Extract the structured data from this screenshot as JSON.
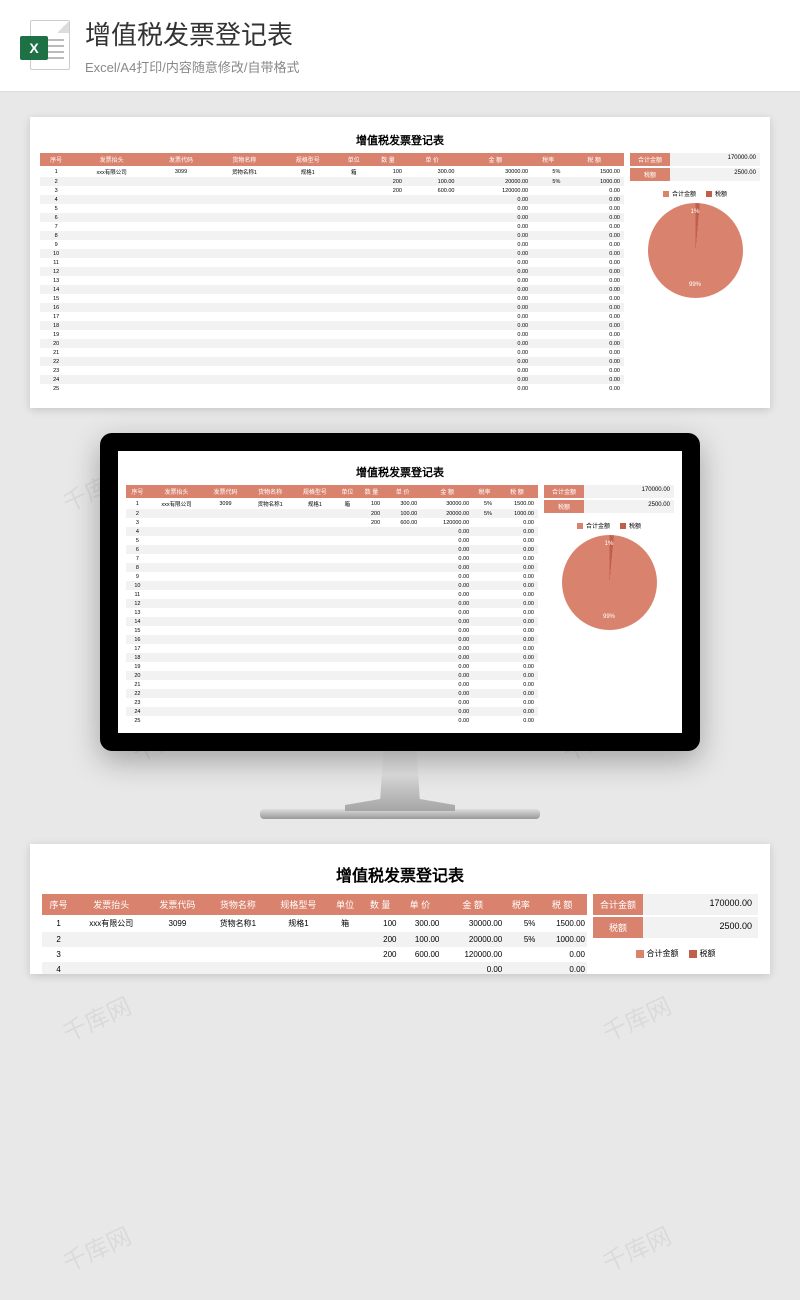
{
  "header": {
    "title": "增值税发票登记表",
    "subtitle": "Excel/A4打印/内容随意修改/自带格式",
    "icon_letter": "X"
  },
  "watermark_text": "千库网",
  "sheet": {
    "title": "增值税发票登记表",
    "columns": [
      "序号",
      "发票抬头",
      "发票代码",
      "货物名称",
      "规格型号",
      "单位",
      "数 量",
      "单 价",
      "金 额",
      "税率",
      "税 额"
    ],
    "rows": [
      {
        "no": "1",
        "head": "xxx有限公司",
        "code": "3099",
        "goods": "货物名称1",
        "spec": "规格1",
        "unit": "箱",
        "qty": "100",
        "price": "300.00",
        "amount": "30000.00",
        "rate": "5%",
        "tax": "1500.00"
      },
      {
        "no": "2",
        "head": "",
        "code": "",
        "goods": "",
        "spec": "",
        "unit": "",
        "qty": "200",
        "price": "100.00",
        "amount": "20000.00",
        "rate": "5%",
        "tax": "1000.00"
      },
      {
        "no": "3",
        "head": "",
        "code": "",
        "goods": "",
        "spec": "",
        "unit": "",
        "qty": "200",
        "price": "600.00",
        "amount": "120000.00",
        "rate": "",
        "tax": "0.00"
      },
      {
        "no": "4",
        "head": "",
        "code": "",
        "goods": "",
        "spec": "",
        "unit": "",
        "qty": "",
        "price": "",
        "amount": "0.00",
        "rate": "",
        "tax": "0.00"
      },
      {
        "no": "5",
        "head": "",
        "code": "",
        "goods": "",
        "spec": "",
        "unit": "",
        "qty": "",
        "price": "",
        "amount": "0.00",
        "rate": "",
        "tax": "0.00"
      },
      {
        "no": "6",
        "head": "",
        "code": "",
        "goods": "",
        "spec": "",
        "unit": "",
        "qty": "",
        "price": "",
        "amount": "0.00",
        "rate": "",
        "tax": "0.00"
      },
      {
        "no": "7",
        "head": "",
        "code": "",
        "goods": "",
        "spec": "",
        "unit": "",
        "qty": "",
        "price": "",
        "amount": "0.00",
        "rate": "",
        "tax": "0.00"
      },
      {
        "no": "8",
        "head": "",
        "code": "",
        "goods": "",
        "spec": "",
        "unit": "",
        "qty": "",
        "price": "",
        "amount": "0.00",
        "rate": "",
        "tax": "0.00"
      },
      {
        "no": "9",
        "head": "",
        "code": "",
        "goods": "",
        "spec": "",
        "unit": "",
        "qty": "",
        "price": "",
        "amount": "0.00",
        "rate": "",
        "tax": "0.00"
      },
      {
        "no": "10",
        "head": "",
        "code": "",
        "goods": "",
        "spec": "",
        "unit": "",
        "qty": "",
        "price": "",
        "amount": "0.00",
        "rate": "",
        "tax": "0.00"
      },
      {
        "no": "11",
        "head": "",
        "code": "",
        "goods": "",
        "spec": "",
        "unit": "",
        "qty": "",
        "price": "",
        "amount": "0.00",
        "rate": "",
        "tax": "0.00"
      },
      {
        "no": "12",
        "head": "",
        "code": "",
        "goods": "",
        "spec": "",
        "unit": "",
        "qty": "",
        "price": "",
        "amount": "0.00",
        "rate": "",
        "tax": "0.00"
      },
      {
        "no": "13",
        "head": "",
        "code": "",
        "goods": "",
        "spec": "",
        "unit": "",
        "qty": "",
        "price": "",
        "amount": "0.00",
        "rate": "",
        "tax": "0.00"
      },
      {
        "no": "14",
        "head": "",
        "code": "",
        "goods": "",
        "spec": "",
        "unit": "",
        "qty": "",
        "price": "",
        "amount": "0.00",
        "rate": "",
        "tax": "0.00"
      },
      {
        "no": "15",
        "head": "",
        "code": "",
        "goods": "",
        "spec": "",
        "unit": "",
        "qty": "",
        "price": "",
        "amount": "0.00",
        "rate": "",
        "tax": "0.00"
      },
      {
        "no": "16",
        "head": "",
        "code": "",
        "goods": "",
        "spec": "",
        "unit": "",
        "qty": "",
        "price": "",
        "amount": "0.00",
        "rate": "",
        "tax": "0.00"
      },
      {
        "no": "17",
        "head": "",
        "code": "",
        "goods": "",
        "spec": "",
        "unit": "",
        "qty": "",
        "price": "",
        "amount": "0.00",
        "rate": "",
        "tax": "0.00"
      },
      {
        "no": "18",
        "head": "",
        "code": "",
        "goods": "",
        "spec": "",
        "unit": "",
        "qty": "",
        "price": "",
        "amount": "0.00",
        "rate": "",
        "tax": "0.00"
      },
      {
        "no": "19",
        "head": "",
        "code": "",
        "goods": "",
        "spec": "",
        "unit": "",
        "qty": "",
        "price": "",
        "amount": "0.00",
        "rate": "",
        "tax": "0.00"
      },
      {
        "no": "20",
        "head": "",
        "code": "",
        "goods": "",
        "spec": "",
        "unit": "",
        "qty": "",
        "price": "",
        "amount": "0.00",
        "rate": "",
        "tax": "0.00"
      },
      {
        "no": "21",
        "head": "",
        "code": "",
        "goods": "",
        "spec": "",
        "unit": "",
        "qty": "",
        "price": "",
        "amount": "0.00",
        "rate": "",
        "tax": "0.00"
      },
      {
        "no": "22",
        "head": "",
        "code": "",
        "goods": "",
        "spec": "",
        "unit": "",
        "qty": "",
        "price": "",
        "amount": "0.00",
        "rate": "",
        "tax": "0.00"
      },
      {
        "no": "23",
        "head": "",
        "code": "",
        "goods": "",
        "spec": "",
        "unit": "",
        "qty": "",
        "price": "",
        "amount": "0.00",
        "rate": "",
        "tax": "0.00"
      },
      {
        "no": "24",
        "head": "",
        "code": "",
        "goods": "",
        "spec": "",
        "unit": "",
        "qty": "",
        "price": "",
        "amount": "0.00",
        "rate": "",
        "tax": "0.00"
      },
      {
        "no": "25",
        "head": "",
        "code": "",
        "goods": "",
        "spec": "",
        "unit": "",
        "qty": "",
        "price": "",
        "amount": "0.00",
        "rate": "",
        "tax": "0.00"
      }
    ],
    "summary": {
      "total_label": "合计金额",
      "total_value": "170000.00",
      "tax_label": "税额",
      "tax_value": "2500.00"
    },
    "legend": {
      "series1": "合计金额",
      "series2": "税额"
    }
  },
  "chart_data": {
    "type": "pie",
    "title": "",
    "series": [
      {
        "name": "合计金额",
        "value": 170000,
        "percent_label": "99%",
        "color": "#d9836e"
      },
      {
        "name": "税额",
        "value": 2500,
        "percent_label": "1%",
        "color": "#c0604a"
      }
    ]
  },
  "colors": {
    "accent": "#d9836e",
    "accent_dark": "#c0604a"
  }
}
